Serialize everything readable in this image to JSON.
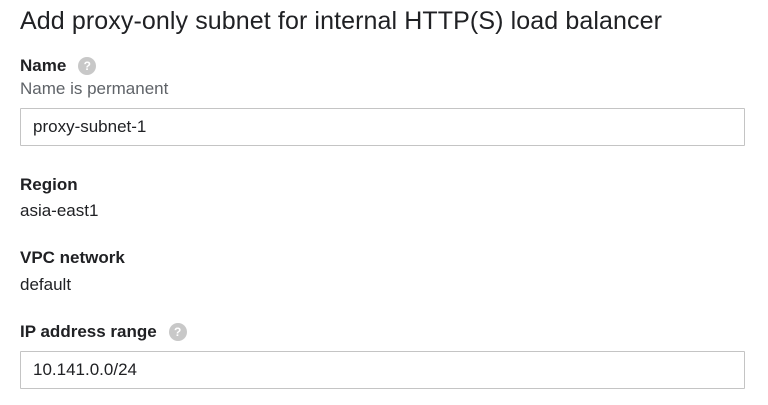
{
  "title": "Add proxy-only subnet for internal HTTP(S) load balancer",
  "name_field": {
    "label": "Name",
    "help_icon": "help-icon",
    "hint": "Name is permanent",
    "value": "proxy-subnet-1"
  },
  "region": {
    "label": "Region",
    "value": "asia-east1"
  },
  "vpc_network": {
    "label": "VPC network",
    "value": "default"
  },
  "ip_range": {
    "label": "IP address range",
    "help_icon": "help-icon",
    "value": "10.141.0.0/24"
  },
  "colors": {
    "text": "#202124",
    "secondary_text": "#5f6368",
    "help_icon": "#c8c8c8",
    "input_border": "#c4c4c4"
  }
}
